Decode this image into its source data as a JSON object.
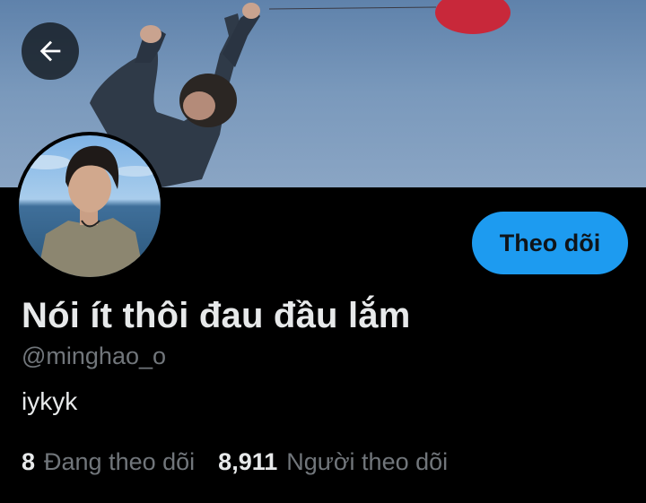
{
  "profile": {
    "display_name": "Nói ít thôi đau đầu lắm",
    "handle": "@minghao_o",
    "bio": "iykyk"
  },
  "actions": {
    "follow_label": "Theo dõi"
  },
  "stats": {
    "following_count": "8",
    "following_label": "Đang theo dõi",
    "followers_count": "8,911",
    "followers_label": "Người theo dõi"
  },
  "icons": {
    "back": "arrow-left-icon"
  },
  "colors": {
    "background": "#000000",
    "accent": "#1d9bf0",
    "primary_text": "#e7e9ea",
    "secondary_text": "#71767b"
  }
}
